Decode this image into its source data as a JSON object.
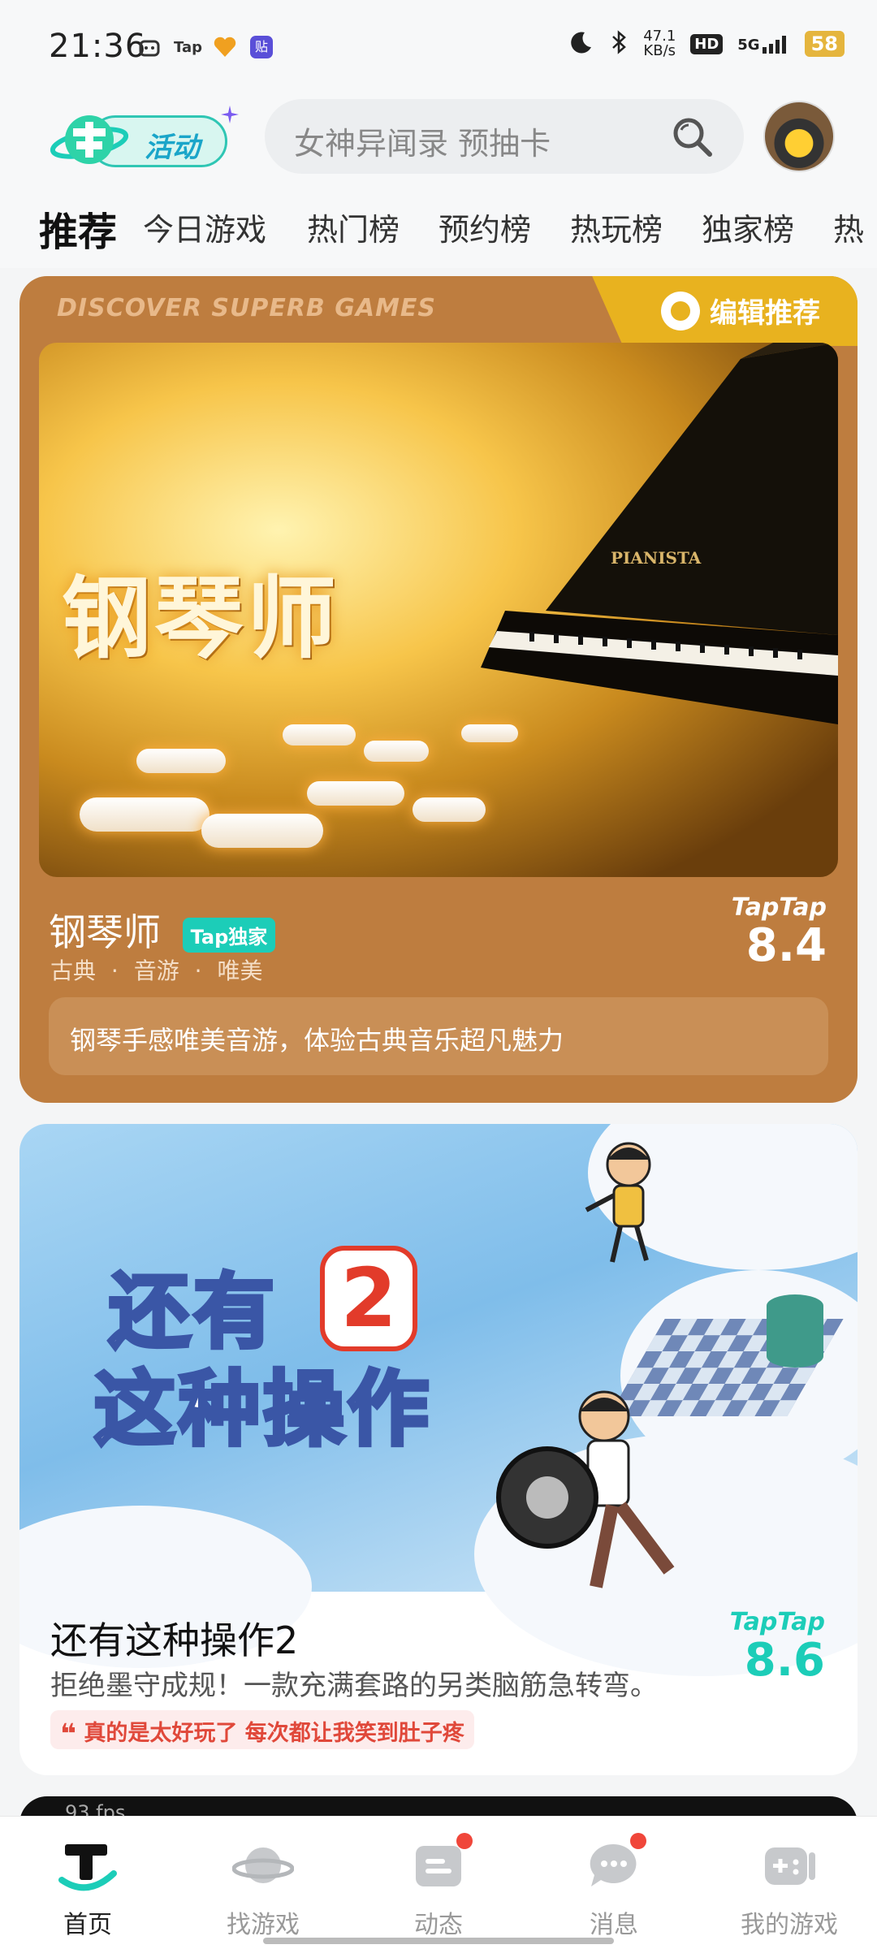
{
  "status_bar": {
    "time": "21:36",
    "tap_label": "Tap",
    "tie_label": "贴",
    "net_speed_value": "47.1",
    "net_speed_unit": "KB/s",
    "hd_label": "HD",
    "signal_label": "5G",
    "battery": "58"
  },
  "header": {
    "activity_label": "活动",
    "search_placeholder": "女神异闻录 预抽卡"
  },
  "tabs": [
    "推荐",
    "今日游戏",
    "热门榜",
    "预约榜",
    "热玩榜",
    "独家榜",
    "热"
  ],
  "featured": {
    "discover_text": "DISCOVER SUPERB GAMES",
    "editor_label": "编辑推荐",
    "banner_title": "钢琴师",
    "piano_brand": "PIANISTA",
    "name": "钢琴师",
    "badge": "Tap独家",
    "tags": [
      "古典",
      "音游",
      "唯美"
    ],
    "score_brand": "TapTap",
    "score": "8.4",
    "description": "钢琴手感唯美音游，体验古典音乐超凡魅力"
  },
  "game2": {
    "banner_line1": "还有",
    "banner_number": "2",
    "banner_line2": "这种操作",
    "name": "还有这种操作2",
    "description": "拒绝墨守成规！一款充满套路的另类脑筋急转弯。",
    "quote": "真的是太好玩了 每次都让我笑到肚子疼",
    "score_brand": "TapTap",
    "score": "8.6"
  },
  "game3": {
    "fps": "93 fps"
  },
  "bottom_nav": [
    {
      "label": "首页",
      "active": true
    },
    {
      "label": "找游戏",
      "active": false
    },
    {
      "label": "动态",
      "active": false,
      "badge": true
    },
    {
      "label": "消息",
      "active": false,
      "badge": true
    },
    {
      "label": "我的游戏",
      "active": false
    }
  ],
  "colors": {
    "accent": "#1ccdb8",
    "featured_bg": "#be7d3f",
    "ribbon": "#e8b21f",
    "quote_red": "#e0483a"
  }
}
